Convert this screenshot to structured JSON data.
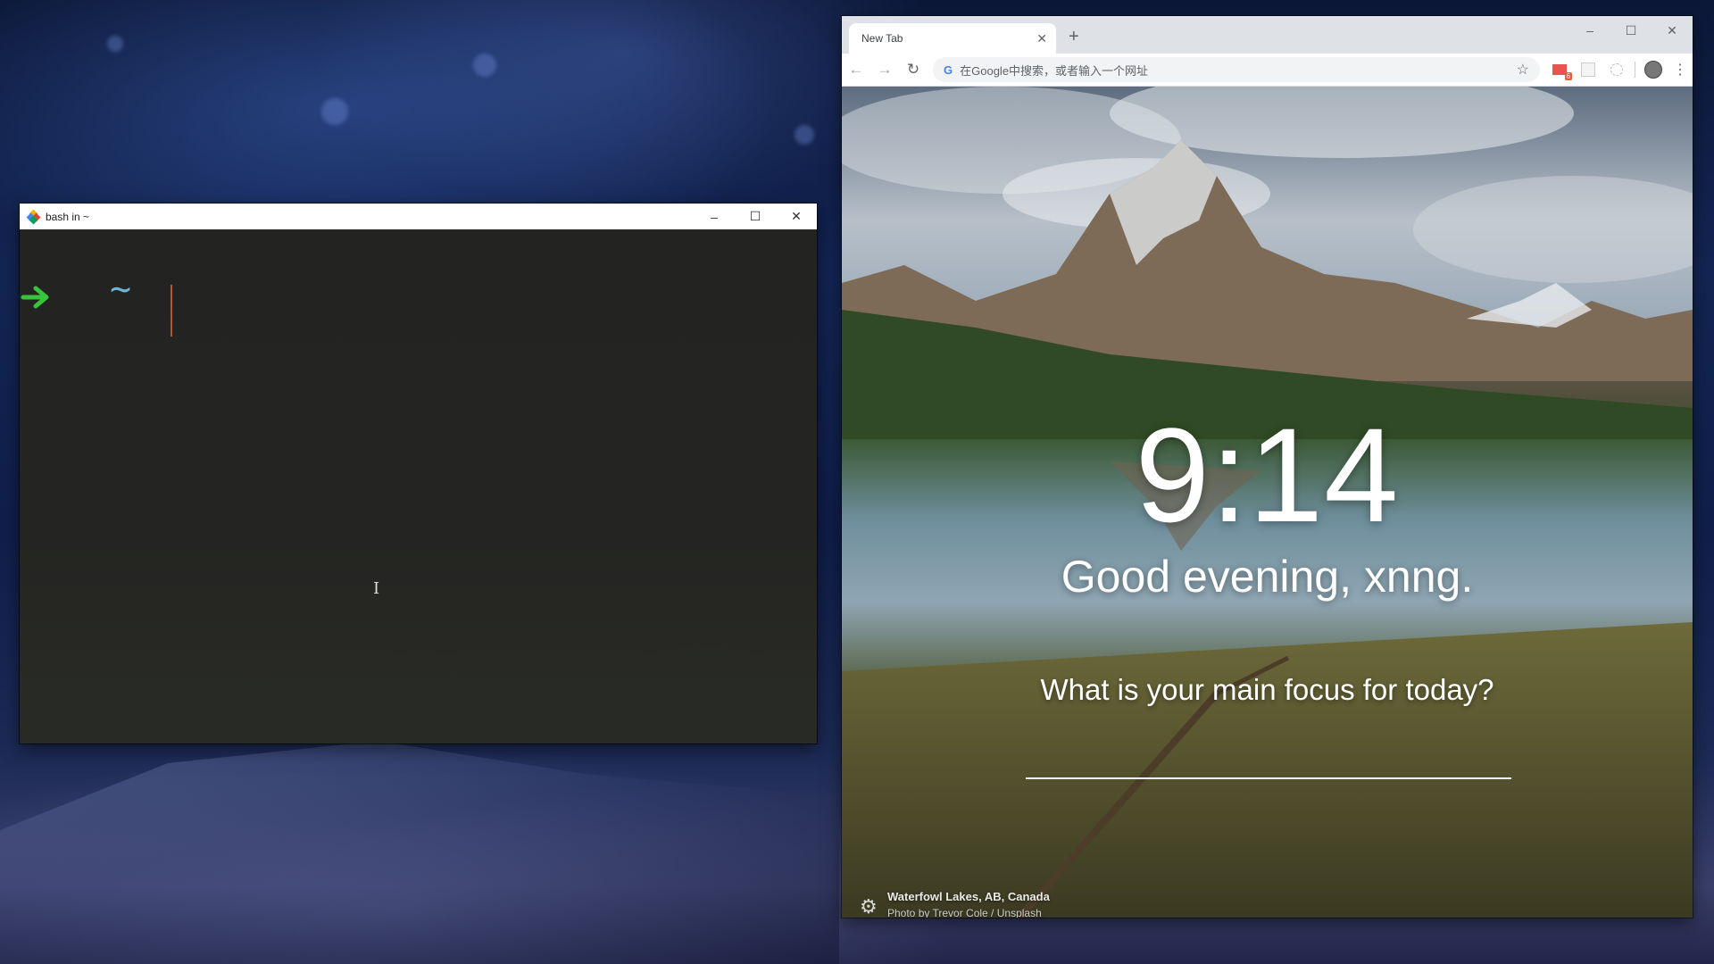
{
  "terminal": {
    "title": "bash in ~",
    "prompt_arrow": "➜",
    "prompt_dir": "~",
    "prompt_arrow_color": "#39c23c",
    "prompt_dir_color": "#6eb4d2"
  },
  "window_controls": {
    "minimize": "–",
    "maximize": "☐",
    "close": "✕"
  },
  "browser": {
    "tab": {
      "title": "New Tab",
      "close": "✕"
    },
    "new_tab": "+",
    "toolbar": {
      "back": "←",
      "forward": "→",
      "reload": "↻",
      "omnibox_placeholder": "在Google中搜索，或者输入一个网址",
      "bookmark_star": "☆",
      "mail_badge": "6",
      "menu": "⋮"
    },
    "momentum": {
      "time": "9:14",
      "greeting": "Good evening, xnng.",
      "focus_question": "What is your main focus for today?",
      "photo_location": "Waterfowl Lakes, AB, Canada",
      "photo_credit": "Photo by Trevor Cole / Unsplash",
      "settings_icon": "gear-icon"
    }
  },
  "colors": {
    "accent_green": "#39c23c",
    "accent_blue": "#6eb4d2",
    "caret": "#b5562a"
  }
}
